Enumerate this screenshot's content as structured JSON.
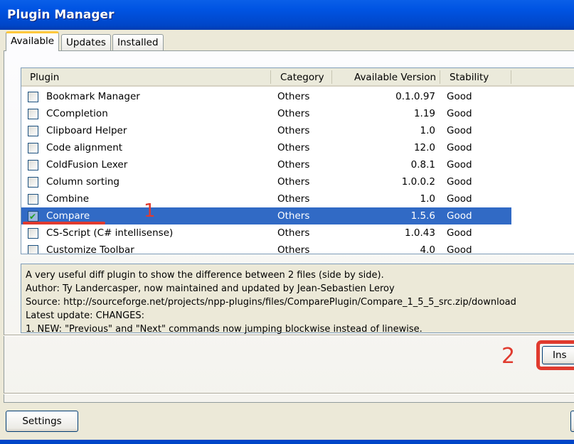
{
  "window": {
    "title": "Plugin Manager"
  },
  "tabs": [
    {
      "label": "Available",
      "active": true
    },
    {
      "label": "Updates"
    },
    {
      "label": "Installed"
    }
  ],
  "columns": [
    "Plugin",
    "Category",
    "Available Version",
    "Stability"
  ],
  "rows": [
    {
      "name": "Bookmark Manager",
      "category": "Others",
      "version": "0.1.0.97",
      "stability": "Good",
      "checked": false
    },
    {
      "name": "CCompletion",
      "category": "Others",
      "version": "1.19",
      "stability": "Good",
      "checked": false
    },
    {
      "name": "Clipboard Helper",
      "category": "Others",
      "version": "1.0",
      "stability": "Good",
      "checked": false
    },
    {
      "name": "Code alignment",
      "category": "Others",
      "version": "12.0",
      "stability": "Good",
      "checked": false
    },
    {
      "name": "ColdFusion Lexer",
      "category": "Others",
      "version": "0.8.1",
      "stability": "Good",
      "checked": false
    },
    {
      "name": "Column sorting",
      "category": "Others",
      "version": "1.0.0.2",
      "stability": "Good",
      "checked": false
    },
    {
      "name": "Combine",
      "category": "Others",
      "version": "1.0",
      "stability": "Good",
      "checked": false
    },
    {
      "name": "Compare",
      "category": "Others",
      "version": "1.5.6",
      "stability": "Good",
      "checked": true,
      "selected": true
    },
    {
      "name": "CS-Script (C# intellisense)",
      "category": "Others",
      "version": "1.0.43",
      "stability": "Good",
      "checked": false
    },
    {
      "name": "Customize Toolbar",
      "category": "Others",
      "version": "4.0",
      "stability": "Good",
      "checked": false
    }
  ],
  "description": [
    "A very useful diff plugin to show the difference between 2 files (side by side).",
    "Author: Ty Landercasper, now maintained and updated by Jean-Sebastien Leroy",
    "Source: http://sourceforge.net/projects/npp-plugins/files/ComparePlugin/Compare_1_5_5_src.zip/download",
    "Latest update: CHANGES:",
    "1. NEW: \"Previous\" and \"Next\" commands now jumping blockwise instead of linewise."
  ],
  "buttons": {
    "install": "Ins",
    "settings": "Settings"
  },
  "annotations": {
    "step1": "1",
    "step2": "2",
    "color": "#e03a2e"
  }
}
